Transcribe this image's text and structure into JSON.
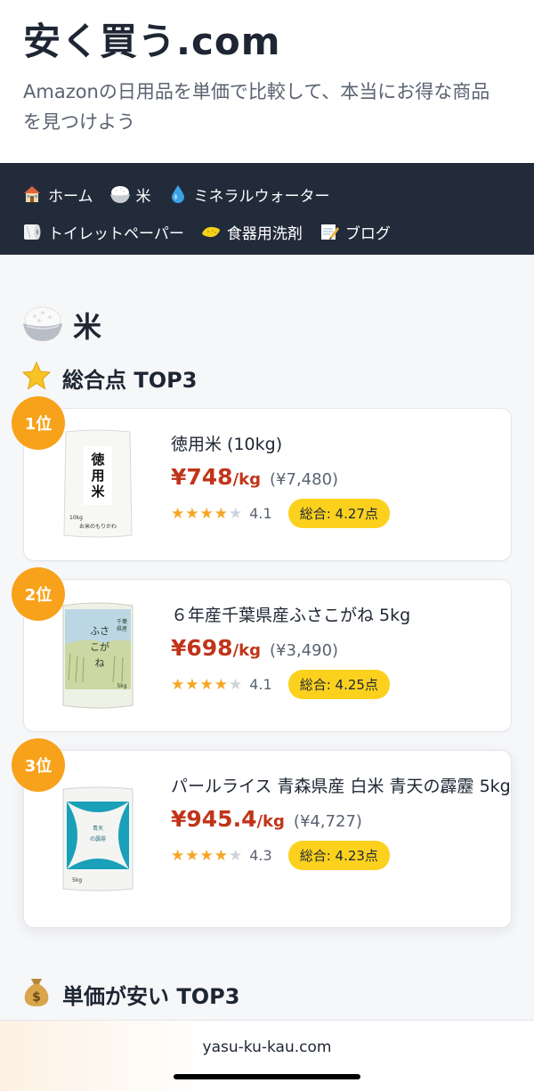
{
  "header": {
    "title": "安く買う.com",
    "description": "Amazonの日用品を単価で比較して、本当にお得な商品を見つけよう"
  },
  "nav": {
    "items": [
      {
        "icon": "house-icon",
        "label": "ホーム"
      },
      {
        "icon": "rice-bowl-icon",
        "label": "米"
      },
      {
        "icon": "water-drop-icon",
        "label": "ミネラルウォーター"
      },
      {
        "icon": "toilet-paper-icon",
        "label": "トイレットペーパー"
      },
      {
        "icon": "sponge-icon",
        "label": "食器用洗剤"
      },
      {
        "icon": "memo-icon",
        "label": "ブログ"
      }
    ]
  },
  "page": {
    "heading": "米",
    "sections": [
      {
        "icon": "star-icon",
        "title": "総合点 TOP3"
      },
      {
        "icon": "money-bag-icon",
        "title": "単価が安い TOP3"
      }
    ]
  },
  "products": [
    {
      "rank": "1位",
      "name": "徳用米 (10kg)",
      "unit_price": "¥748",
      "unit_suffix": "/kg",
      "total_price": "(¥7,480)",
      "stars": 4,
      "rating": "4.1",
      "score": "総合: 4.27点",
      "image_labels": {
        "main": "徳用米",
        "maker": "お米のもりかわ",
        "weight": "10kg"
      }
    },
    {
      "rank": "2位",
      "name": "６年産千葉県産ふさこがね 5kg",
      "unit_price": "¥698",
      "unit_suffix": "/kg",
      "total_price": "(¥3,490)",
      "stars": 4,
      "rating": "4.1",
      "score": "総合: 4.25点",
      "image_labels": {
        "main": "ふさこがね",
        "region": "千葉県産",
        "weight": "5kg"
      }
    },
    {
      "rank": "3位",
      "name": "パールライス 青森県産 白米 青天の霹靂 5kg",
      "unit_price": "¥945.4",
      "unit_suffix": "/kg",
      "total_price": "(¥4,727)",
      "stars": 4,
      "rating": "4.3",
      "score": "総合: 4.23点",
      "image_labels": {
        "main": "青天の霹靂",
        "weight": "5kg"
      }
    }
  ],
  "footer": {
    "url": "yasu-ku-kau.com"
  },
  "colors": {
    "nav_bg": "#222b3a",
    "price": "#c0351a",
    "rank_badge": "#f7a21a",
    "score_pill": "#fcd11e",
    "star": "#f5a623"
  }
}
